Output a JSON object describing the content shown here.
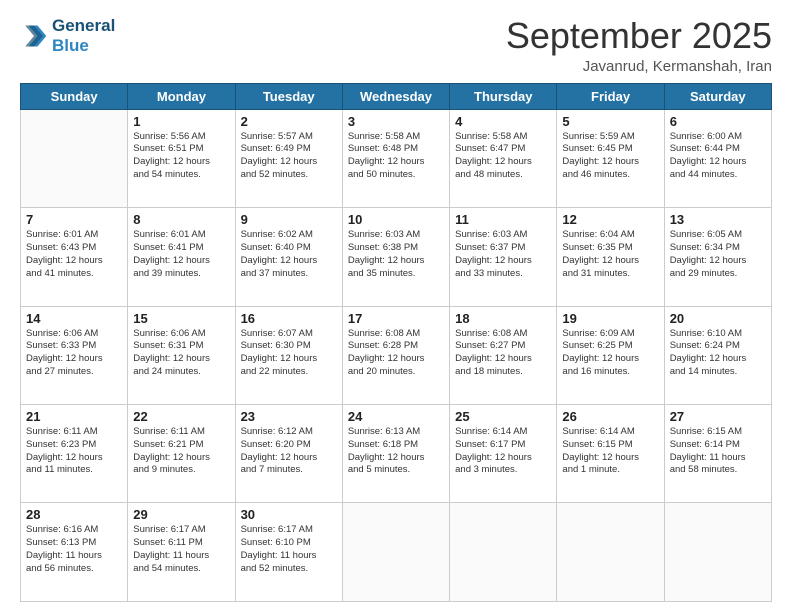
{
  "header": {
    "logo_line1": "General",
    "logo_line2": "Blue",
    "month_title": "September 2025",
    "subtitle": "Javanrud, Kermanshah, Iran"
  },
  "days_of_week": [
    "Sunday",
    "Monday",
    "Tuesday",
    "Wednesday",
    "Thursday",
    "Friday",
    "Saturday"
  ],
  "weeks": [
    [
      {
        "day": "",
        "text": ""
      },
      {
        "day": "1",
        "text": "Sunrise: 5:56 AM\nSunset: 6:51 PM\nDaylight: 12 hours\nand 54 minutes."
      },
      {
        "day": "2",
        "text": "Sunrise: 5:57 AM\nSunset: 6:49 PM\nDaylight: 12 hours\nand 52 minutes."
      },
      {
        "day": "3",
        "text": "Sunrise: 5:58 AM\nSunset: 6:48 PM\nDaylight: 12 hours\nand 50 minutes."
      },
      {
        "day": "4",
        "text": "Sunrise: 5:58 AM\nSunset: 6:47 PM\nDaylight: 12 hours\nand 48 minutes."
      },
      {
        "day": "5",
        "text": "Sunrise: 5:59 AM\nSunset: 6:45 PM\nDaylight: 12 hours\nand 46 minutes."
      },
      {
        "day": "6",
        "text": "Sunrise: 6:00 AM\nSunset: 6:44 PM\nDaylight: 12 hours\nand 44 minutes."
      }
    ],
    [
      {
        "day": "7",
        "text": "Sunrise: 6:01 AM\nSunset: 6:43 PM\nDaylight: 12 hours\nand 41 minutes."
      },
      {
        "day": "8",
        "text": "Sunrise: 6:01 AM\nSunset: 6:41 PM\nDaylight: 12 hours\nand 39 minutes."
      },
      {
        "day": "9",
        "text": "Sunrise: 6:02 AM\nSunset: 6:40 PM\nDaylight: 12 hours\nand 37 minutes."
      },
      {
        "day": "10",
        "text": "Sunrise: 6:03 AM\nSunset: 6:38 PM\nDaylight: 12 hours\nand 35 minutes."
      },
      {
        "day": "11",
        "text": "Sunrise: 6:03 AM\nSunset: 6:37 PM\nDaylight: 12 hours\nand 33 minutes."
      },
      {
        "day": "12",
        "text": "Sunrise: 6:04 AM\nSunset: 6:35 PM\nDaylight: 12 hours\nand 31 minutes."
      },
      {
        "day": "13",
        "text": "Sunrise: 6:05 AM\nSunset: 6:34 PM\nDaylight: 12 hours\nand 29 minutes."
      }
    ],
    [
      {
        "day": "14",
        "text": "Sunrise: 6:06 AM\nSunset: 6:33 PM\nDaylight: 12 hours\nand 27 minutes."
      },
      {
        "day": "15",
        "text": "Sunrise: 6:06 AM\nSunset: 6:31 PM\nDaylight: 12 hours\nand 24 minutes."
      },
      {
        "day": "16",
        "text": "Sunrise: 6:07 AM\nSunset: 6:30 PM\nDaylight: 12 hours\nand 22 minutes."
      },
      {
        "day": "17",
        "text": "Sunrise: 6:08 AM\nSunset: 6:28 PM\nDaylight: 12 hours\nand 20 minutes."
      },
      {
        "day": "18",
        "text": "Sunrise: 6:08 AM\nSunset: 6:27 PM\nDaylight: 12 hours\nand 18 minutes."
      },
      {
        "day": "19",
        "text": "Sunrise: 6:09 AM\nSunset: 6:25 PM\nDaylight: 12 hours\nand 16 minutes."
      },
      {
        "day": "20",
        "text": "Sunrise: 6:10 AM\nSunset: 6:24 PM\nDaylight: 12 hours\nand 14 minutes."
      }
    ],
    [
      {
        "day": "21",
        "text": "Sunrise: 6:11 AM\nSunset: 6:23 PM\nDaylight: 12 hours\nand 11 minutes."
      },
      {
        "day": "22",
        "text": "Sunrise: 6:11 AM\nSunset: 6:21 PM\nDaylight: 12 hours\nand 9 minutes."
      },
      {
        "day": "23",
        "text": "Sunrise: 6:12 AM\nSunset: 6:20 PM\nDaylight: 12 hours\nand 7 minutes."
      },
      {
        "day": "24",
        "text": "Sunrise: 6:13 AM\nSunset: 6:18 PM\nDaylight: 12 hours\nand 5 minutes."
      },
      {
        "day": "25",
        "text": "Sunrise: 6:14 AM\nSunset: 6:17 PM\nDaylight: 12 hours\nand 3 minutes."
      },
      {
        "day": "26",
        "text": "Sunrise: 6:14 AM\nSunset: 6:15 PM\nDaylight: 12 hours\nand 1 minute."
      },
      {
        "day": "27",
        "text": "Sunrise: 6:15 AM\nSunset: 6:14 PM\nDaylight: 11 hours\nand 58 minutes."
      }
    ],
    [
      {
        "day": "28",
        "text": "Sunrise: 6:16 AM\nSunset: 6:13 PM\nDaylight: 11 hours\nand 56 minutes."
      },
      {
        "day": "29",
        "text": "Sunrise: 6:17 AM\nSunset: 6:11 PM\nDaylight: 11 hours\nand 54 minutes."
      },
      {
        "day": "30",
        "text": "Sunrise: 6:17 AM\nSunset: 6:10 PM\nDaylight: 11 hours\nand 52 minutes."
      },
      {
        "day": "",
        "text": ""
      },
      {
        "day": "",
        "text": ""
      },
      {
        "day": "",
        "text": ""
      },
      {
        "day": "",
        "text": ""
      }
    ]
  ]
}
